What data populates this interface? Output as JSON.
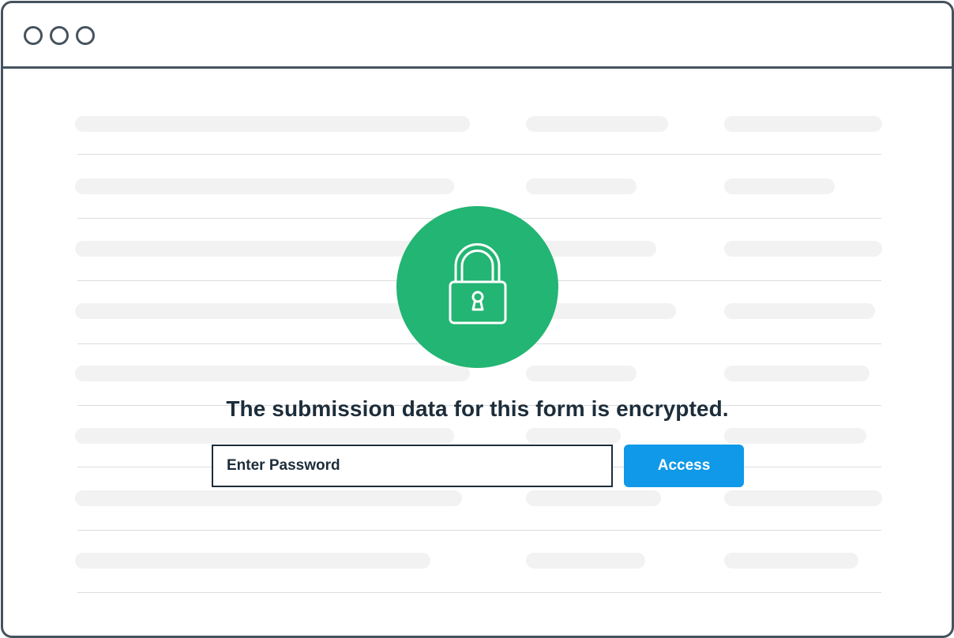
{
  "window": {
    "controls": [
      "window-dot-icon",
      "window-dot-icon",
      "window-dot-icon"
    ]
  },
  "lock": {
    "icon": "padlock-icon",
    "color": "#23b573"
  },
  "message": "The submission data for this form is encrypted.",
  "password": {
    "placeholder": "Enter Password",
    "value": ""
  },
  "access_button": {
    "label": "Access",
    "color": "#0f99e8"
  },
  "colors": {
    "frame": "#45535e",
    "text": "#1d2d3a",
    "placeholder_bar": "#f2f2f2",
    "rule": "#d9dcde"
  }
}
